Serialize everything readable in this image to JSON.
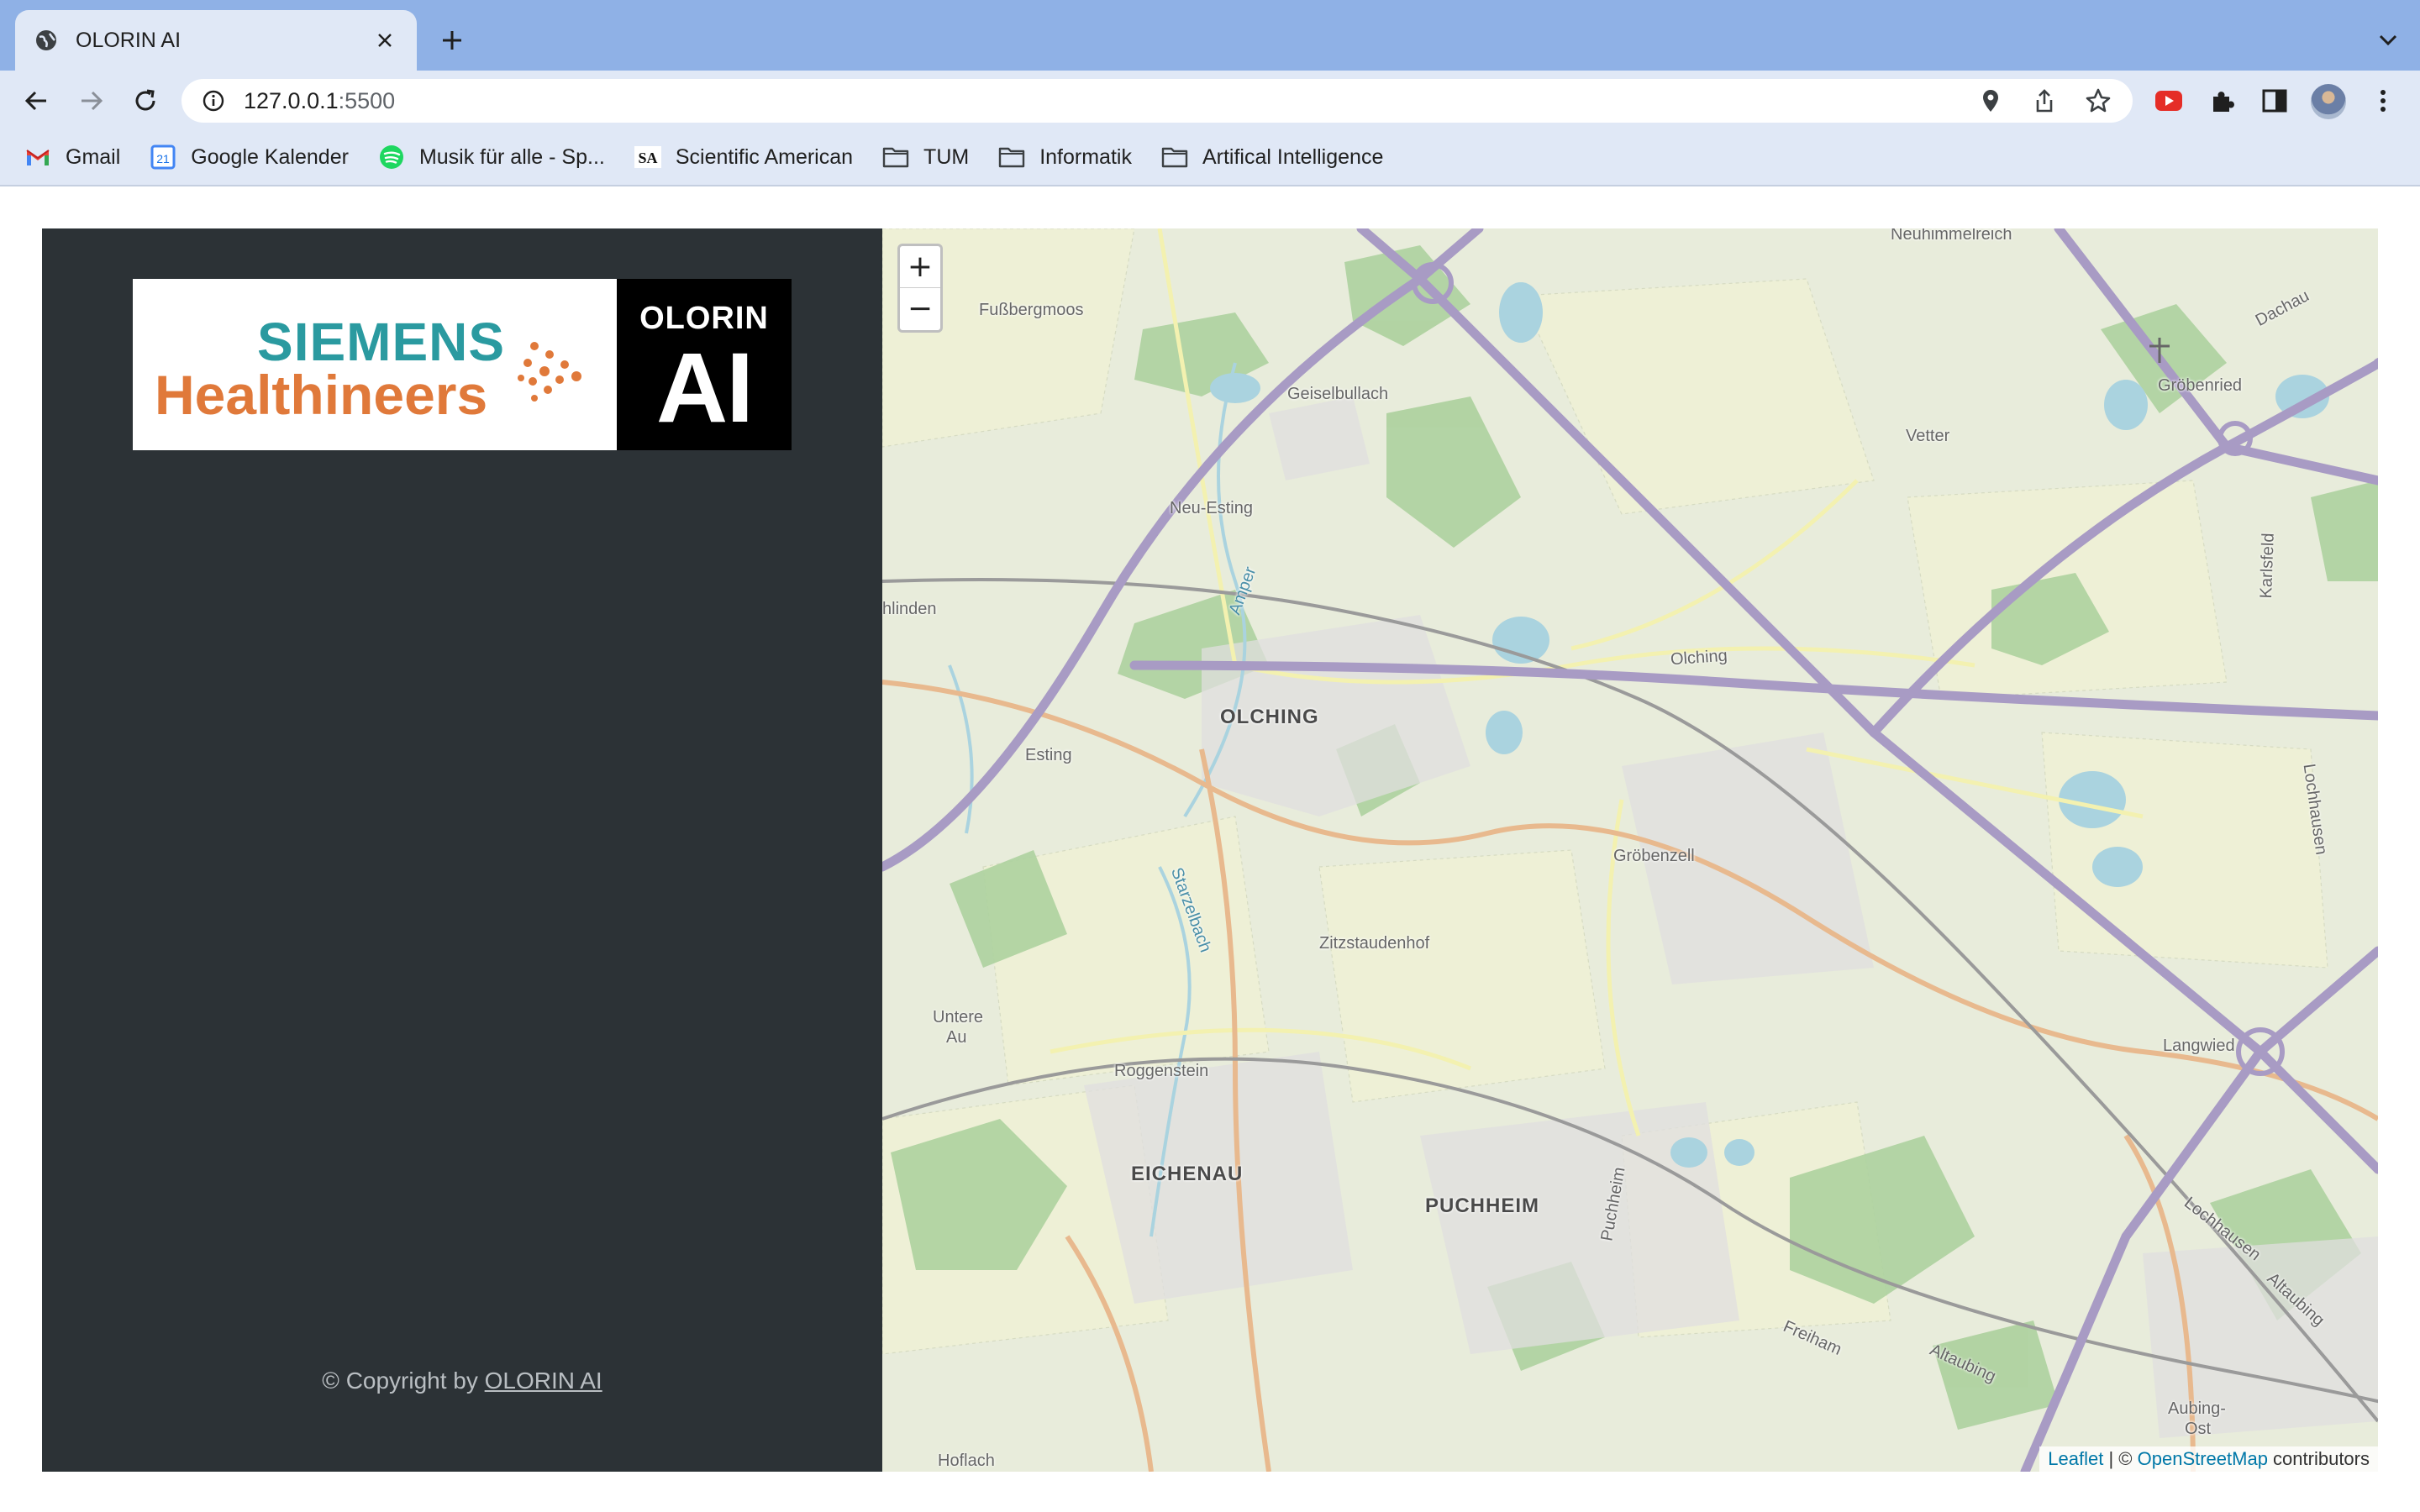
{
  "browser": {
    "tab_title": "OLORIN AI",
    "url_host": "127.0.0.1",
    "url_port": ":5500",
    "bookmarks": [
      {
        "label": "Gmail",
        "icon": "gmail-icon"
      },
      {
        "label": "Google Kalender",
        "icon": "calendar-icon"
      },
      {
        "label": "Musik für alle - Sp...",
        "icon": "spotify-icon"
      },
      {
        "label": "Scientific American",
        "icon": "sa-icon"
      },
      {
        "label": "TUM",
        "icon": "folder-icon"
      },
      {
        "label": "Informatik",
        "icon": "folder-icon"
      },
      {
        "label": "Artifical Intelligence",
        "icon": "folder-icon"
      }
    ],
    "calendar_day": "21",
    "sa_mark": "SA"
  },
  "sidebar": {
    "logo": {
      "siemens": "SIEMENS",
      "healthineers": "Healthineers",
      "olorin": "OLORIN",
      "ai": "AI"
    },
    "copyright_prefix": "© Copyright by ",
    "copyright_link": "OLORIN AI"
  },
  "map": {
    "zoom_in": "+",
    "zoom_out": "−",
    "attribution_leaflet": "Leaflet",
    "attribution_sep": " | © ",
    "attribution_osm": "OpenStreetMap",
    "attribution_suffix": " contributors",
    "places": {
      "neuhimmelreich": "Neuhimmelreich",
      "fussbergmoos": "Fußbergmoos",
      "dachau": "Dachau",
      "geiselbullach": "Geiselbullach",
      "groebenried": "Gröbenried",
      "vetter": "Vetter",
      "neu_esting": "Neu-Esting",
      "linden": "hlinden",
      "karlsfeld": "Karlsfeld",
      "olching_road": "Olching",
      "olching": "OLCHING",
      "esting": "Esting",
      "lochhausen": "Lochhausen",
      "groebenzell": "Gröbenzell",
      "starzelbach": "Starzelbach",
      "zitzstaudenhof": "Zitzstaudenhof",
      "untere": "Untere",
      "au": "Au",
      "langwied": "Langwied",
      "roggenstein": "Roggenstein",
      "eichenau": "EICHENAU",
      "puchheim": "PUCHHEIM",
      "puchheim_road": "Puchheim",
      "lochhausen2": "Lochhausen",
      "aubing_road": "Altaubing",
      "freiham": "Freiham",
      "altaubing": "Altaubing",
      "aubing_ost": "Aubing-",
      "ost": "Ost",
      "hoflach": "Hoflach",
      "amper": "Amper"
    }
  },
  "colors": {
    "tabstrip": "#8fb1e6",
    "toolbar": "#e0e8f6",
    "sidebar": "#2c3236",
    "map_land": "#e8ecdb",
    "motorway": "#a89bc4",
    "road": "#e8b98e",
    "water": "#aad3df",
    "forest": "#add19e",
    "link": "#0078a8"
  }
}
